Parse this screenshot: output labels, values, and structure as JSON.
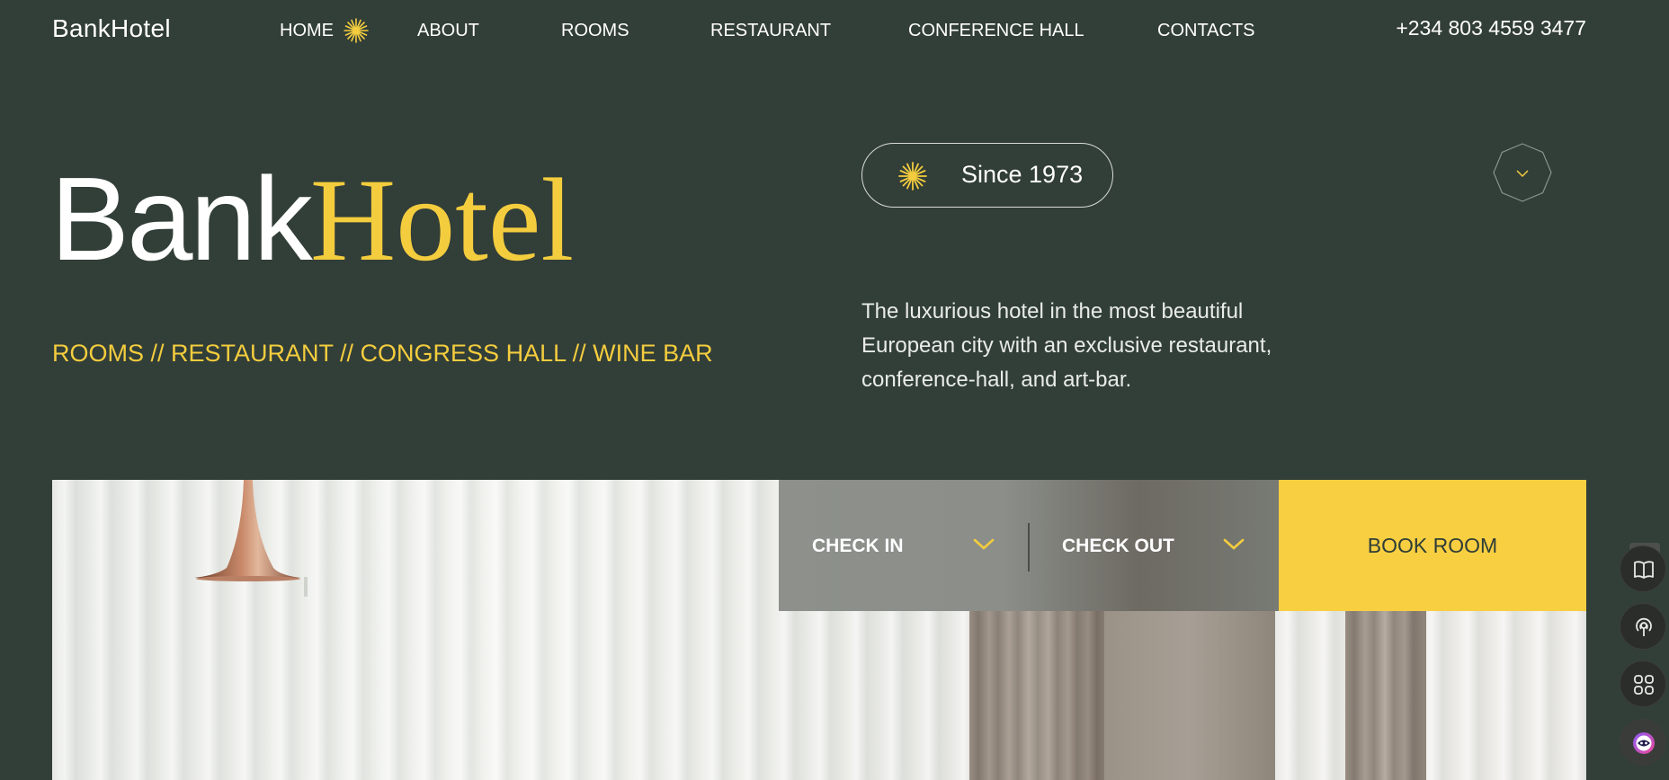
{
  "brand": {
    "small_logo": "BankHotel",
    "hero_part1": "Bank",
    "hero_part2": "Hotel"
  },
  "nav": {
    "items": [
      {
        "label": "HOME",
        "active": true
      },
      {
        "label": "ABOUT"
      },
      {
        "label": "ROOMS"
      },
      {
        "label": "RESTAURANT"
      },
      {
        "label": "CONFERENCE HALL"
      },
      {
        "label": "CONTACTS"
      }
    ],
    "phone": "+234 803 4559 3477"
  },
  "hero": {
    "tagline": "ROOMS // RESTAURANT // CONGRESS HALL // WINE BAR",
    "since_badge": "Since 1973",
    "description": "The luxurious hotel in the most beautiful European city with an exclusive restaurant, conference-hall, and art-bar."
  },
  "booking": {
    "check_in_label": "CHECK IN",
    "check_out_label": "CHECK OUT",
    "book_button": "BOOK ROOM"
  },
  "colors": {
    "background": "#323e38",
    "accent_yellow": "#f4cd3e",
    "button_yellow": "#f9cf42",
    "text_white": "#ffffff"
  },
  "icons": {
    "nav_active_marker": "sparkle-star-icon",
    "badge": "sparkle-star-icon",
    "scroll": "chevron-down-icon",
    "side_panel": [
      "book-icon",
      "broadcast-icon",
      "apps-grid-icon",
      "assistant-avatar-icon"
    ]
  }
}
